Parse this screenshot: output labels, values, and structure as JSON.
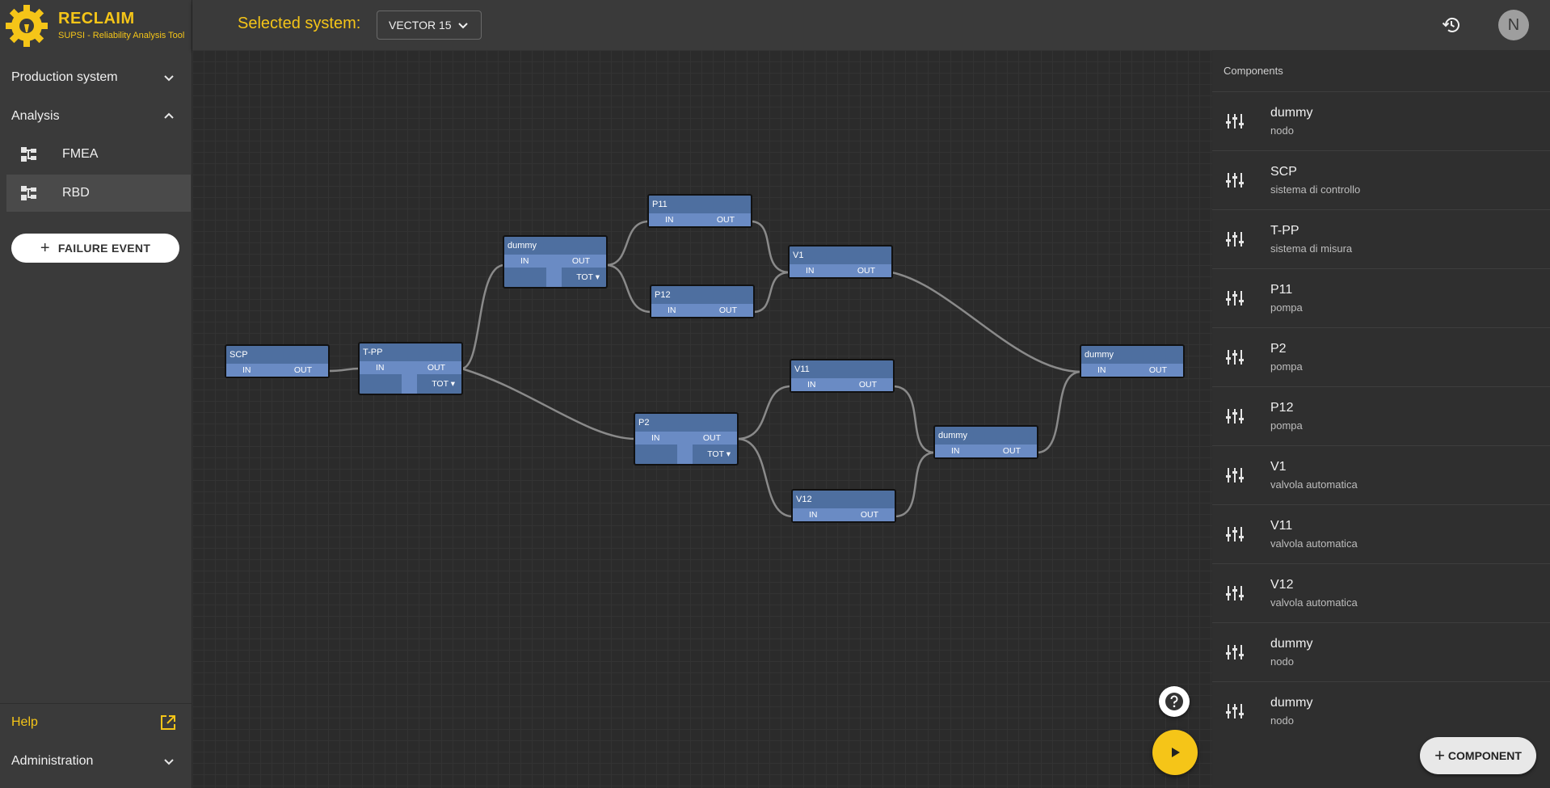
{
  "brand": {
    "title": "RECLAIM",
    "subtitle": "SUPSI - Reliability Analysis Tool"
  },
  "sidebar": {
    "production_system": "Production system",
    "analysis": "Analysis",
    "items": [
      {
        "label": "FMEA",
        "icon": "tree-icon"
      },
      {
        "label": "RBD",
        "icon": "tree-icon",
        "active": true
      }
    ],
    "failure_event": "FAILURE EVENT",
    "help": "Help",
    "administration": "Administration"
  },
  "header": {
    "selected_label": "Selected system:",
    "selected_value": "VECTOR 15",
    "avatar": "N"
  },
  "panel": {
    "title": "Components",
    "components": [
      {
        "name": "dummy",
        "desc": "nodo"
      },
      {
        "name": "SCP",
        "desc": "sistema di controllo"
      },
      {
        "name": "T-PP",
        "desc": "sistema di misura"
      },
      {
        "name": "P11",
        "desc": "pompa"
      },
      {
        "name": "P2",
        "desc": "pompa"
      },
      {
        "name": "P12",
        "desc": "pompa"
      },
      {
        "name": "V1",
        "desc": "valvola automatica"
      },
      {
        "name": "V11",
        "desc": "valvola automatica"
      },
      {
        "name": "V12",
        "desc": "valvola automatica"
      },
      {
        "name": "dummy",
        "desc": "nodo"
      },
      {
        "name": "dummy",
        "desc": "nodo"
      }
    ],
    "add_button": "COMPONENT"
  },
  "diagram": {
    "port_in": "IN",
    "port_out": "OUT",
    "tot_label": "TOT ▾",
    "nodes": [
      {
        "id": "scp",
        "title": "SCP",
        "tot": false
      },
      {
        "id": "tpp",
        "title": "T-PP",
        "tot": true
      },
      {
        "id": "dummy1",
        "title": "dummy",
        "tot": true
      },
      {
        "id": "p11",
        "title": "P11",
        "tot": false
      },
      {
        "id": "p12",
        "title": "P12",
        "tot": false
      },
      {
        "id": "v1",
        "title": "V1",
        "tot": false
      },
      {
        "id": "p2",
        "title": "P2",
        "tot": true
      },
      {
        "id": "v11",
        "title": "V11",
        "tot": false
      },
      {
        "id": "v12",
        "title": "V12",
        "tot": false
      },
      {
        "id": "dummy2",
        "title": "dummy",
        "tot": false
      },
      {
        "id": "dummy3",
        "title": "dummy",
        "tot": false
      }
    ]
  }
}
